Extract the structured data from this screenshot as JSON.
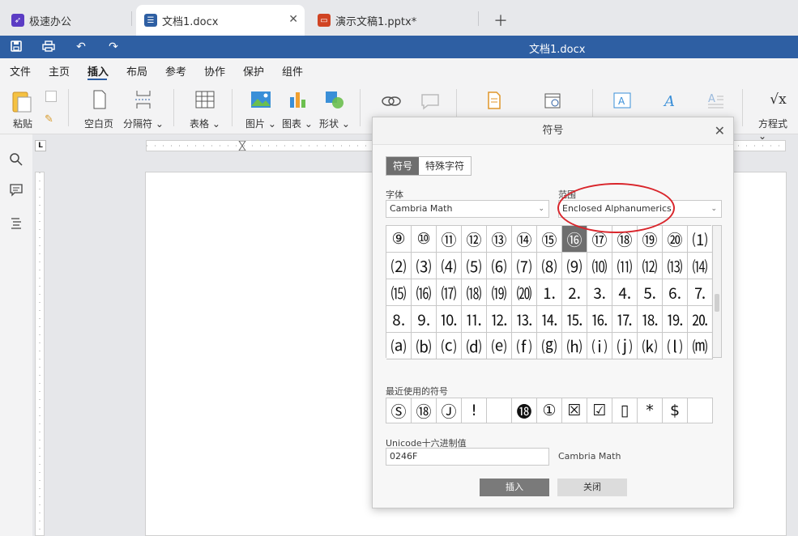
{
  "tabs": [
    {
      "label": "极速办公",
      "icon_color": "#5b3cc4"
    },
    {
      "label": "文档1.docx",
      "icon_color": "#2e5fa3"
    },
    {
      "label": "演示文稿1.pptx*",
      "icon_color": "#d04423"
    }
  ],
  "titlebar": {
    "title": "文档1.docx",
    "color": "#2e5fa3"
  },
  "menu": [
    "文件",
    "主页",
    "插入",
    "布局",
    "参考",
    "协作",
    "保护",
    "组件"
  ],
  "ribbon": {
    "paste": "粘贴",
    "blank_page": "空白页",
    "separator": "分隔符",
    "table": "表格",
    "picture": "图片",
    "chart": "图表",
    "shape": "形状",
    "equation": "方程式"
  },
  "dialog": {
    "title": "符号",
    "tab_symbol": "符号",
    "tab_special": "特殊字符",
    "font_label": "字体",
    "font_value": "Cambria Math",
    "range_label": "范围",
    "range_value": "Enclosed Alphanumerics",
    "symbols": [
      "⑨",
      "⑩",
      "⑪",
      "⑫",
      "⑬",
      "⑭",
      "⑮",
      "⑯",
      "⑰",
      "⑱",
      "⑲",
      "⑳",
      "⑴",
      "⑵",
      "⑶",
      "⑷",
      "⑸",
      "⑹",
      "⑺",
      "⑻",
      "⑼",
      "⑽",
      "⑾",
      "⑿",
      "⒀",
      "⒁",
      "⒂",
      "⒃",
      "⒄",
      "⒅",
      "⒆",
      "⒇",
      "⒈",
      "⒉",
      "⒊",
      "⒋",
      "⒌",
      "⒍",
      "⒎",
      "⒏",
      "⒐",
      "⒑",
      "⒒",
      "⒓",
      "⒔",
      "⒕",
      "⒖",
      "⒗",
      "⒘",
      "⒙",
      "⒚",
      "⒛",
      "⒜",
      "⒝",
      "⒞",
      "⒟",
      "⒠",
      "⒡",
      "⒢",
      "⒣",
      "⒤",
      "⒥",
      "⒦",
      "⒧",
      "⒨"
    ],
    "recent_label": "最近使用的符号",
    "recent": [
      "Ⓢ",
      "⑱",
      "Ⓙ",
      "!",
      "",
      "⓲",
      "①",
      "☒",
      "☑",
      "▯",
      "*",
      "$",
      ""
    ],
    "unicode_label": "Unicode十六进制值",
    "unicode_value": "0246F",
    "unicode_font": "Cambria Math",
    "insert": "插入",
    "close": "关闭"
  }
}
